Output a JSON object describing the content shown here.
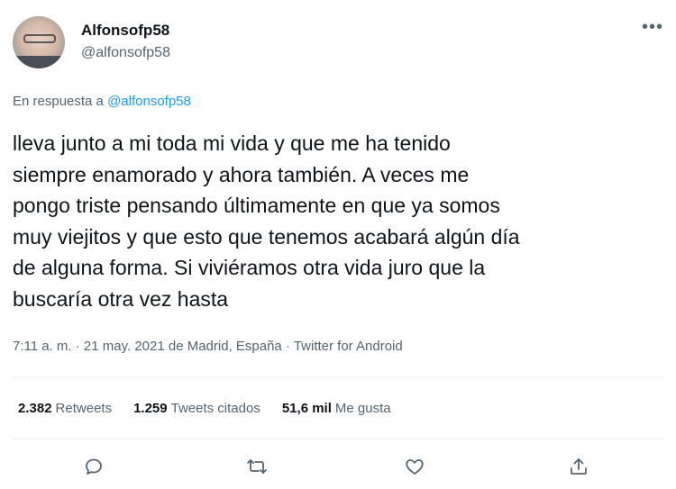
{
  "author": {
    "display_name": "Alfonsofp58",
    "handle": "@alfonsofp58"
  },
  "more_label": "•••",
  "reply_context": {
    "prefix": "En respuesta a ",
    "mention": "@alfonsofp58"
  },
  "tweet": {
    "text": "lleva junto a mi toda mi vida y que me ha tenido\nsiempre enamorado y ahora también. A veces me\npongo triste pensando últimamente en que ya somos\nmuy viejitos y que esto que tenemos acabará algún día\nde alguna forma. Si viviéramos otra vida juro que la\nbuscaría otra vez hasta",
    "timestamp": "7:11 a. m. · 21 may. 2021 de Madrid, España · Twitter for Android"
  },
  "stats": {
    "retweets_count": "2.382",
    "retweets_label": "Retweets",
    "quotes_count": "1.259",
    "quotes_label": "Tweets citados",
    "likes_count": "51,6 mil",
    "likes_label": "Me gusta"
  },
  "actions": {
    "reply_icon": "reply-icon",
    "retweet_icon": "retweet-icon",
    "like_icon": "like-icon",
    "share_icon": "share-icon"
  },
  "colors": {
    "text": "#0f1419",
    "secondary": "#536471",
    "accent": "#1d9bf0",
    "divider": "#eff3f4"
  }
}
